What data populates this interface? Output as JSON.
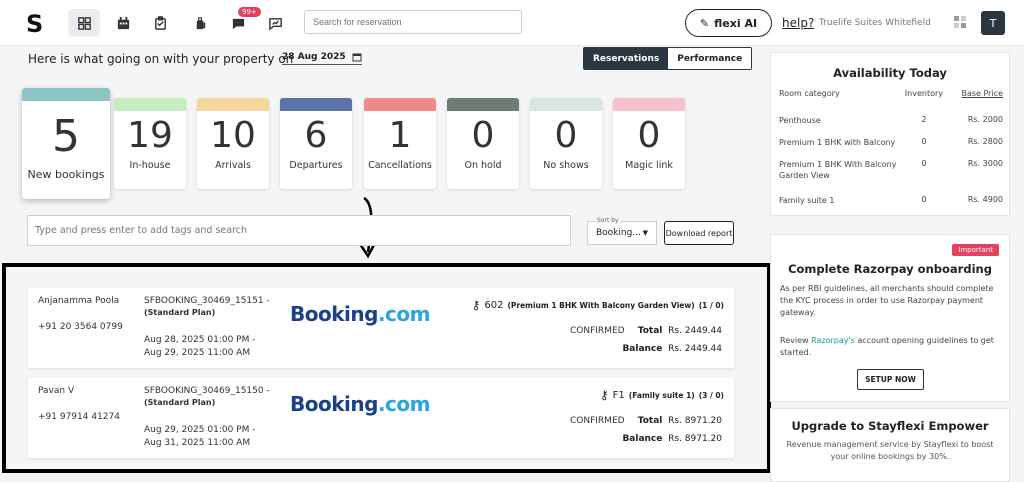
{
  "brand": {
    "logo": "S"
  },
  "nav": {
    "badge": "99+"
  },
  "search": {
    "placeholder": "Search for reservation"
  },
  "header": {
    "flexi_label": "flexi AI",
    "help_label": "help?",
    "property_name": "Truelife Suites Whitefield",
    "avatar_initial": "T"
  },
  "overview": {
    "headline": "Here is what going on with your property on",
    "date": "28 Aug 2025",
    "tab_reservations": "Reservations",
    "tab_performance": "Performance"
  },
  "stats": [
    {
      "value": "5",
      "label": "New bookings",
      "color": "#8dc4c4"
    },
    {
      "value": "19",
      "label": "In-house",
      "color": "#c6ecc1"
    },
    {
      "value": "10",
      "label": "Arrivals",
      "color": "#f6d79b"
    },
    {
      "value": "6",
      "label": "Departures",
      "color": "#5a74a8"
    },
    {
      "value": "1",
      "label": "Cancellations",
      "color": "#f08a8a"
    },
    {
      "value": "0",
      "label": "On hold",
      "color": "#6e7d74"
    },
    {
      "value": "0",
      "label": "No shows",
      "color": "#d9e5df"
    },
    {
      "value": "0",
      "label": "Magic link",
      "color": "#f8c2cc"
    }
  ],
  "filters": {
    "tag_placeholder": "Type and press enter to add tags and search",
    "sort_label": "Sort by",
    "sort_value": "Booking...",
    "download_label": "Download report"
  },
  "reservations": [
    {
      "guest": "Anjanamma Poola",
      "phone": "+91 20 3564 0799",
      "booking_id": "SFBOOKING_30469_15151 -",
      "plan": "(Standard Plan)",
      "dates": "Aug 28, 2025 01:00 PM - Aug 29, 2025 11:00 AM",
      "source_main": "Booking",
      "source_suffix": ".com",
      "room_no": "602",
      "room_type": "(Premium 1 BHK With Balcony Garden View)",
      "occupancy": "(1 / 0)",
      "status": "CONFIRMED",
      "total_label": "Total",
      "total": "Rs. 2449.44",
      "balance_label": "Balance",
      "balance": "Rs. 2449.44"
    },
    {
      "guest": "Pavan V",
      "phone": "+91 97914 41274",
      "booking_id": "SFBOOKING_30469_15150 -",
      "plan": "(Standard Plan)",
      "dates": "Aug 29, 2025 01:00 PM - Aug 31, 2025 11:00 AM",
      "source_main": "Booking",
      "source_suffix": ".com",
      "room_no": "F1",
      "room_type": "(Family suite 1)",
      "occupancy": "(3 / 0)",
      "status": "CONFIRMED",
      "total_label": "Total",
      "total": "Rs. 8971.20",
      "balance_label": "Balance",
      "balance": "Rs. 8971.20"
    }
  ],
  "availability": {
    "title": "Availability Today",
    "col_category": "Room category",
    "col_inventory": "Inventory",
    "col_price": "Base Price",
    "rows": [
      {
        "name": "Penthouse",
        "inv": "2",
        "price": "Rs. 2000"
      },
      {
        "name": "Premium 1 BHK with Balcony",
        "inv": "0",
        "price": "Rs. 2800"
      },
      {
        "name": "Premium 1 BHK With Balcony Garden View",
        "inv": "0",
        "price": "Rs. 3000"
      },
      {
        "name": "Family suite 1",
        "inv": "0",
        "price": "Rs. 4900"
      }
    ]
  },
  "razorpay": {
    "badge": "Important",
    "title": "Complete Razorpay onboarding",
    "text1": "As per RBI guidelines, all merchants should complete the KYC process in order to use Razorpay payment gateway.",
    "text2_pre": "Review ",
    "text2_link": "Razorpay's",
    "text2_post": " account opening guidelines to get started.",
    "button": "SETUP NOW"
  },
  "empower": {
    "title": "Upgrade to Stayflexi Empower",
    "text": "Revenue management service by Stayflexi to boost your online bookings by 30%."
  }
}
